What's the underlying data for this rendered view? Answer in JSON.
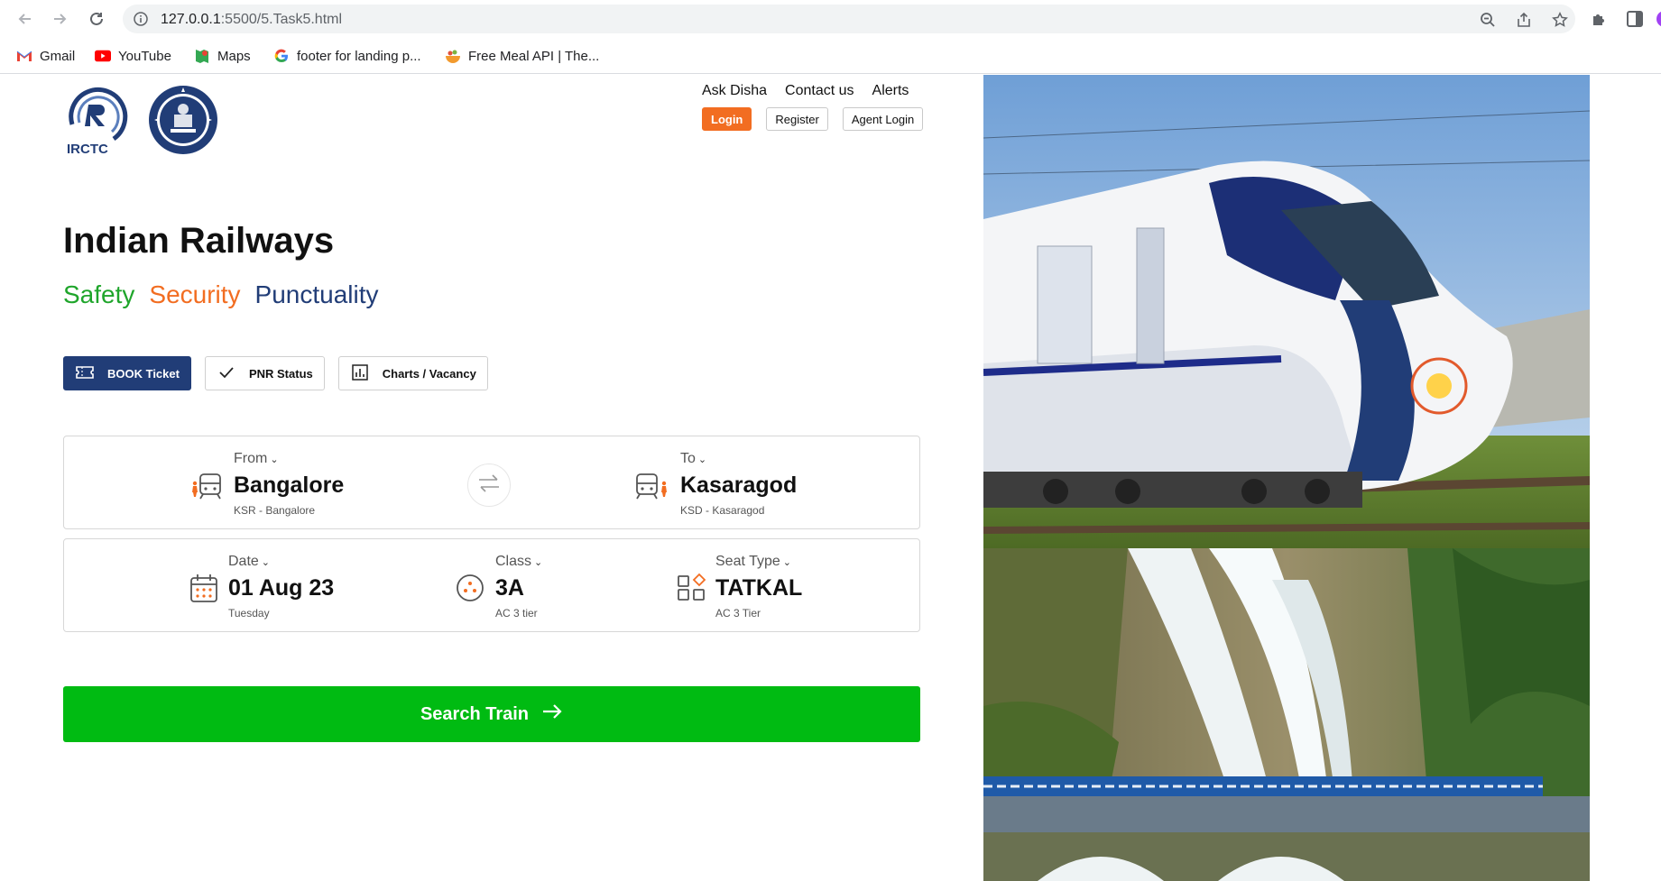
{
  "browser": {
    "url_host": "127.0.0.1",
    "url_path": ":5500/5.Task5.html",
    "bookmarks": [
      {
        "label": "Gmail",
        "icon": "gmail-icon"
      },
      {
        "label": "YouTube",
        "icon": "youtube-icon"
      },
      {
        "label": "Maps",
        "icon": "maps-icon"
      },
      {
        "label": "footer for landing p...",
        "icon": "google-icon"
      },
      {
        "label": "Free Meal API | The...",
        "icon": "meal-icon"
      }
    ]
  },
  "header": {
    "logo_text": "IRCTC",
    "links": [
      "Ask Disha",
      "Contact us",
      "Alerts"
    ],
    "buttons": {
      "login": "Login",
      "register": "Register",
      "agent_login": "Agent Login"
    }
  },
  "hero": {
    "title": "Indian Railways",
    "tagline": {
      "safety": "Safety",
      "security": "Security",
      "punctuality": "Punctuality"
    }
  },
  "tabs": [
    {
      "label": "BOOK Ticket",
      "icon": "ticket-icon",
      "active": true
    },
    {
      "label": "PNR Status",
      "icon": "check-icon",
      "active": false
    },
    {
      "label": "Charts / Vacancy",
      "icon": "chart-icon",
      "active": false
    }
  ],
  "route": {
    "from": {
      "label": "From",
      "value": "Bangalore",
      "sub": "KSR - Bangalore"
    },
    "to": {
      "label": "To",
      "value": "Kasaragod",
      "sub": "KSD - Kasaragod"
    }
  },
  "details": {
    "date": {
      "label": "Date",
      "value": "01 Aug 23",
      "sub": "Tuesday"
    },
    "class": {
      "label": "Class",
      "value": "3A",
      "sub": "AC 3 tier"
    },
    "seat": {
      "label": "Seat Type",
      "value": "TATKAL",
      "sub": "AC 3 Tier"
    }
  },
  "search": {
    "label": "Search Train"
  },
  "colors": {
    "brand_navy": "#213d77",
    "accent_orange": "#f26d21",
    "safety_green": "#1fa52b",
    "search_green": "#00bb12"
  }
}
